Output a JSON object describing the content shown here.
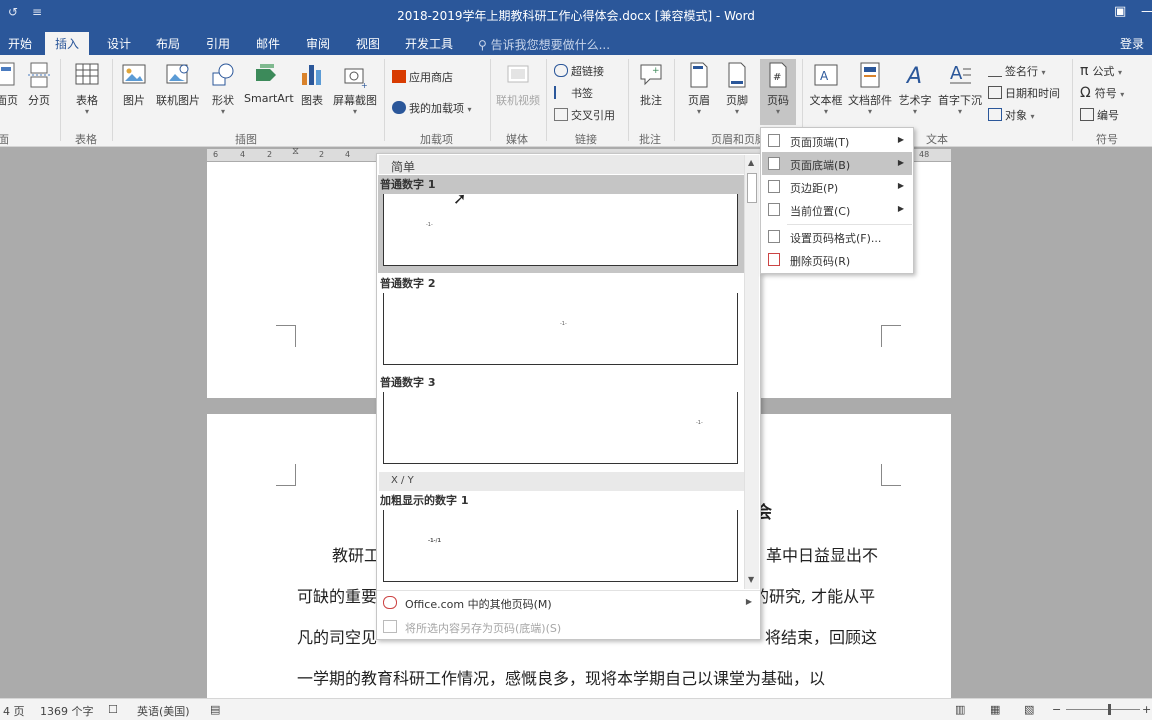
{
  "window": {
    "title": "2018-2019学年上期教科研工作心得体会.docx [兼容模式] - Word",
    "restore_icon": "restore-ribbon-icon",
    "minimize_label": "—",
    "maximize_label": "☐"
  },
  "tabs": [
    {
      "label": "开始"
    },
    {
      "label": "插入"
    },
    {
      "label": "设计"
    },
    {
      "label": "布局"
    },
    {
      "label": "引用"
    },
    {
      "label": "邮件"
    },
    {
      "label": "审阅"
    },
    {
      "label": "视图"
    },
    {
      "label": "开发工具"
    }
  ],
  "active_tab": "插入",
  "tellme_placeholder": "告诉我您想要做什么...",
  "login_label": "登录",
  "ribbon": {
    "pages": {
      "cover_label": "面页",
      "break_label": "分页",
      "group_label": "页面"
    },
    "table": {
      "label": "表格",
      "group_label": "表格"
    },
    "illustrations": {
      "picture": "图片",
      "online_picture": "联机图片",
      "shapes": "形状",
      "smartart": "SmartArt",
      "chart": "图表",
      "screenshot": "屏幕截图",
      "group_label": "插图"
    },
    "addins": {
      "store": "应用商店",
      "my_addins": "我的加载项",
      "group_label": "加载项"
    },
    "media": {
      "online_video": "联机视频",
      "group_label": "媒体"
    },
    "links": {
      "hyperlink": "超链接",
      "bookmark": "书签",
      "cross_ref": "交叉引用",
      "group_label": "链接"
    },
    "comments": {
      "comment": "批注",
      "group_label": "批注"
    },
    "header_footer": {
      "header": "页眉",
      "footer": "页脚",
      "page_number": "页码",
      "group_label": "页眉和页脚"
    },
    "text": {
      "textbox": "文本框",
      "quickparts": "文档部件",
      "wordart": "艺术字",
      "dropcap": "首字下沉",
      "signature": "签名行",
      "datetime": "日期和时间",
      "object": "对象",
      "group_label": "文本"
    },
    "symbols": {
      "equation": "公式",
      "symbol": "符号",
      "numbering": "编号",
      "group_label": "符号"
    }
  },
  "ruler": {
    "ticks": [
      "6",
      "4",
      "2",
      "2",
      "4",
      "48"
    ]
  },
  "gallery": {
    "section_simple": "简单",
    "section_xy": "X / Y",
    "items": [
      {
        "title": "普通数字 1",
        "sample": "-1-"
      },
      {
        "title": "普通数字 2",
        "sample": "-1-"
      },
      {
        "title": "普通数字 3",
        "sample": "-1-"
      },
      {
        "title": "加粗显示的数字 1",
        "sample": "-1-/1"
      }
    ],
    "more_pages": "Office.com 中的其他页码(M)",
    "save_selection": "将所选内容另存为页码(底端)(S)"
  },
  "submenu": {
    "items": [
      {
        "label": "页面顶端(T)",
        "has_arrow": true
      },
      {
        "label": "页面底端(B)",
        "has_arrow": true,
        "highlighted": true
      },
      {
        "label": "页边距(P)",
        "has_arrow": true
      },
      {
        "label": "当前位置(C)",
        "has_arrow": true
      },
      {
        "label": "设置页码格式(F)...",
        "has_arrow": false
      },
      {
        "label": "删除页码(R)",
        "has_arrow": false
      }
    ]
  },
  "document": {
    "heading_fragment": "会",
    "line1_left": "教研工",
    "line1_right": "革中日益显出不",
    "line2_left": "可缺的重要",
    "line2_right": "的研究, 才能从平",
    "line3_left": "凡的司空见",
    "line3_right": "将结束，回顾这",
    "line4": "一学期的教育科研工作情况，感慨良多，现将本学期自己以课堂为基础，以"
  },
  "status": {
    "pages": "4 页",
    "words": "1369 个字",
    "language": "英语(美国)"
  },
  "colors": {
    "accent": "#2b579a",
    "ribbon_bg": "#f3f3f3",
    "highlight": "#c5c5c5"
  }
}
